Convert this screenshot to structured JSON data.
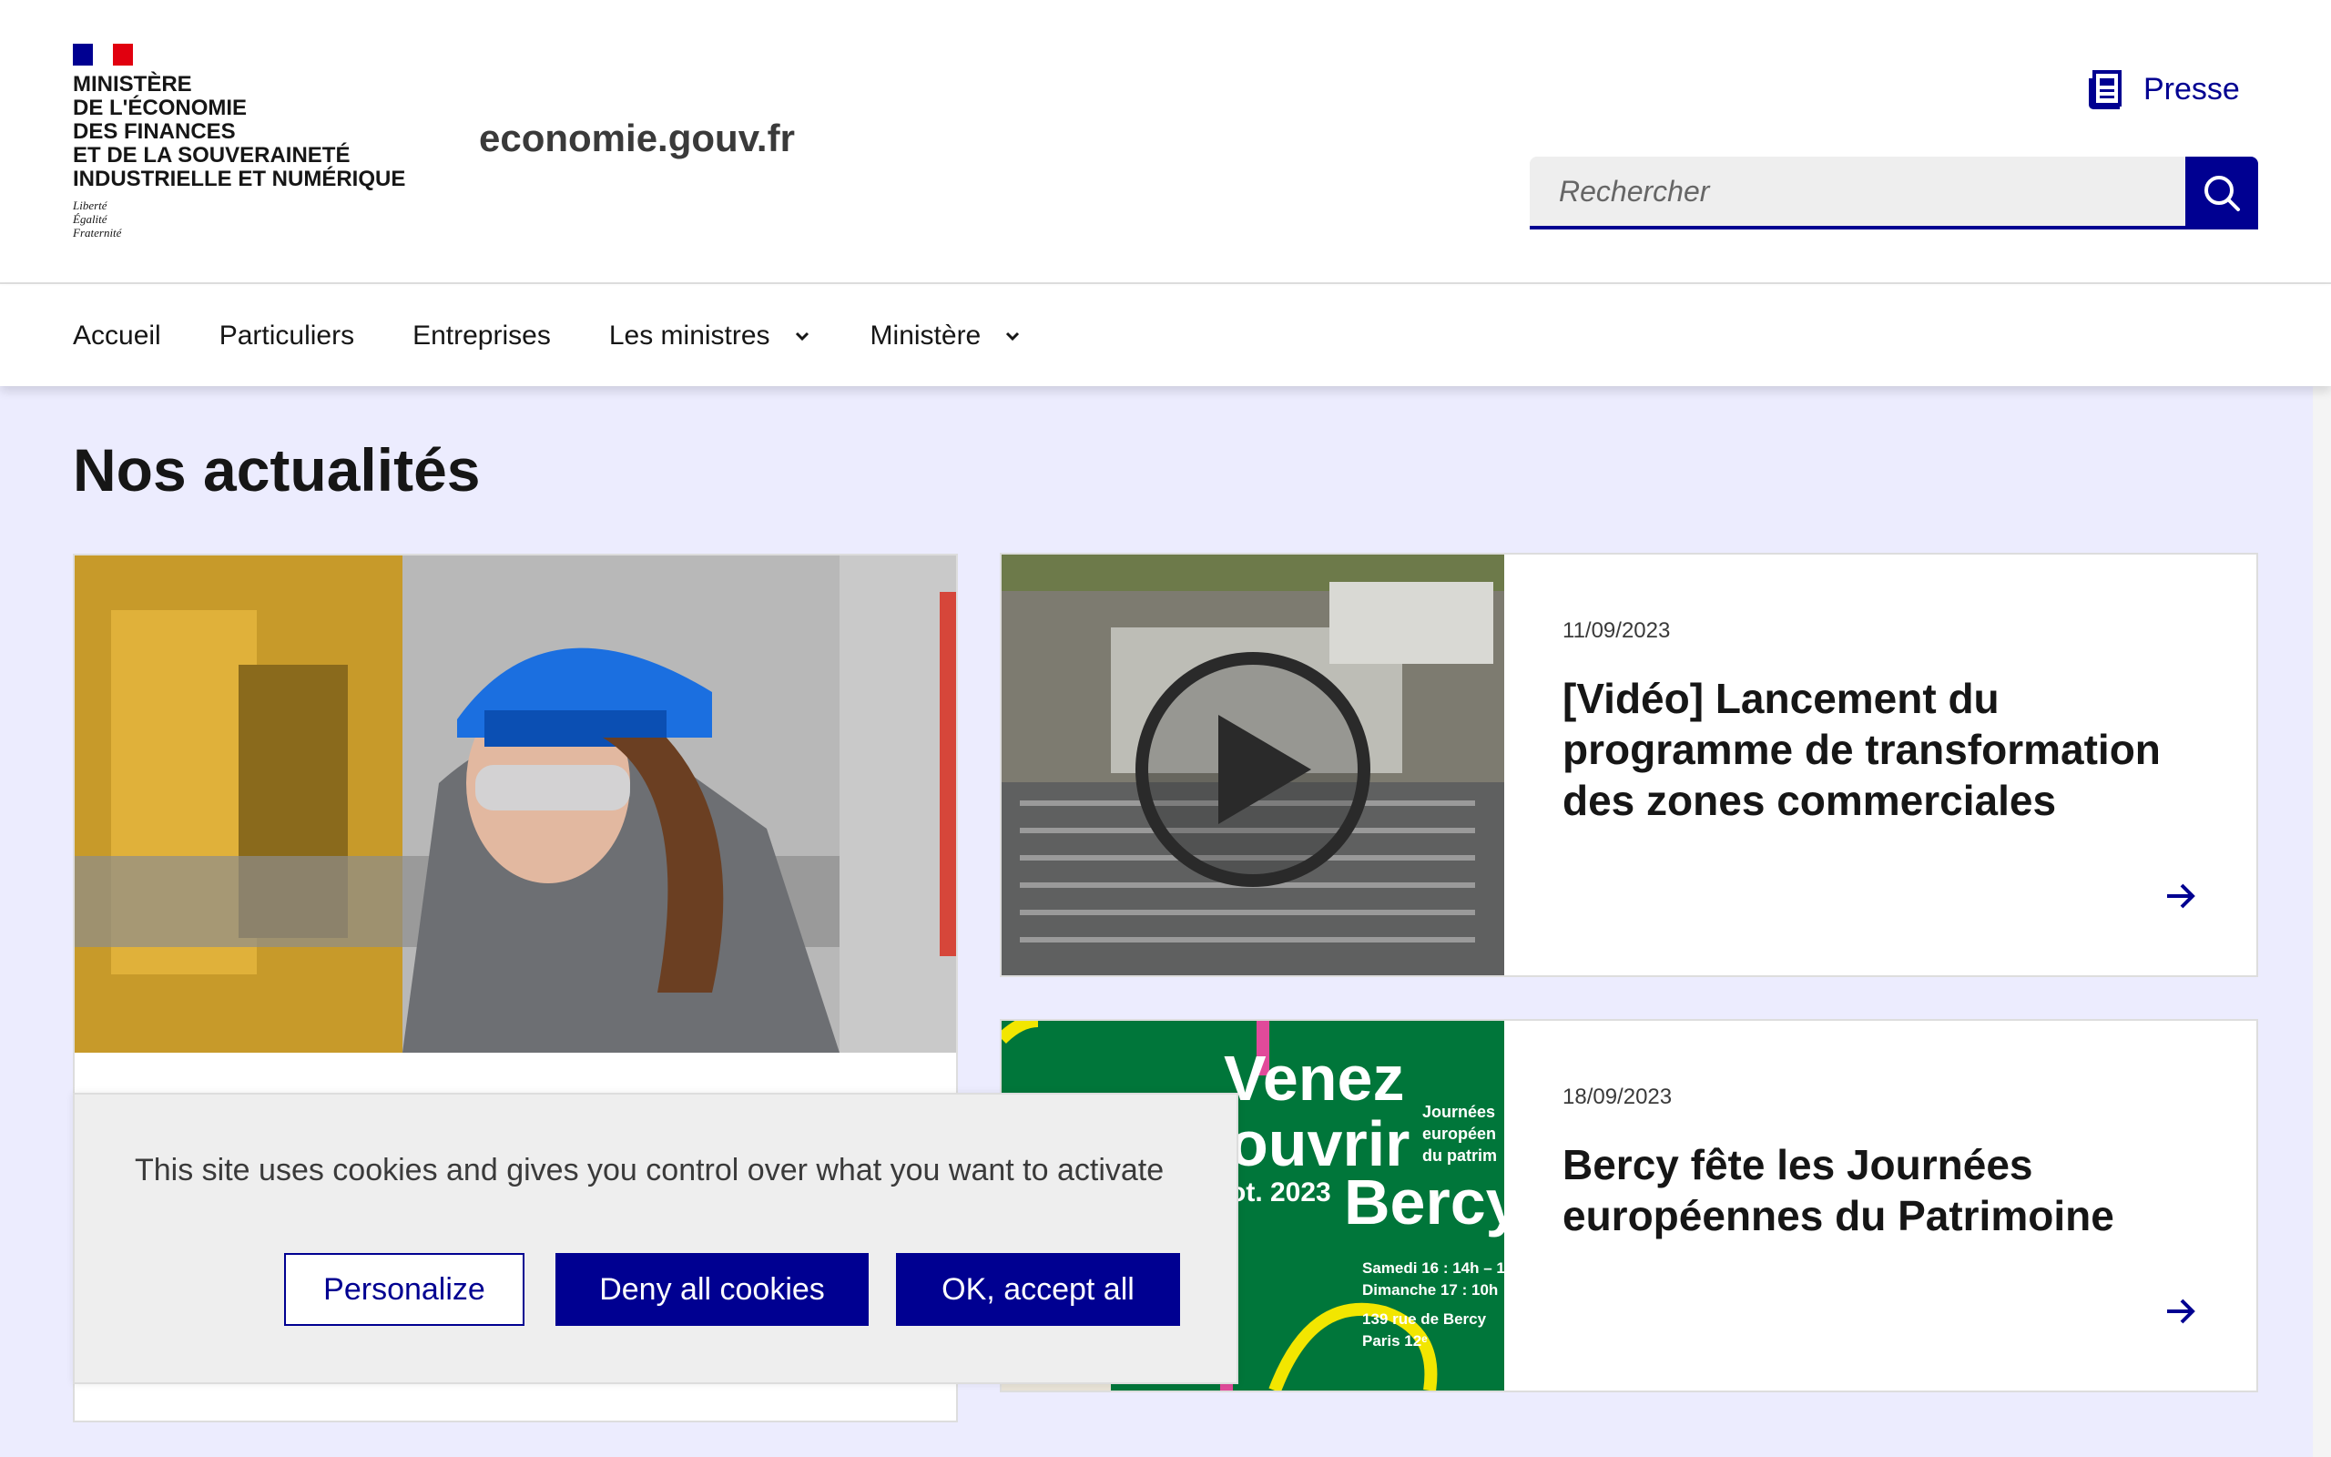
{
  "header": {
    "ministry_lines": [
      "Ministère",
      "de l'Économie",
      "des Finances",
      "et de la Souveraineté",
      "industrielle et numérique"
    ],
    "motto_lines": [
      "Liberté",
      "Égalité",
      "Fraternité"
    ],
    "site_name": "economie.gouv.fr",
    "press_label": "Presse",
    "press_icon": "newspaper-icon",
    "search_placeholder": "Rechercher",
    "search_icon": "search-icon"
  },
  "nav": {
    "items": [
      {
        "label": "Accueil"
      },
      {
        "label": "Particuliers"
      },
      {
        "label": "Entreprises"
      },
      {
        "label": "Les ministres",
        "dropdown": true
      },
      {
        "label": "Ministère",
        "dropdown": true
      }
    ]
  },
  "main": {
    "title": "Nos actualités",
    "cards": [
      {
        "date": "11/09/2023",
        "title": "[Vidéo] Lancement du programme de transformation des zones commerciales",
        "media": "video-thumbnail"
      },
      {
        "date": "18/09/2023",
        "title": "Bercy fête les Journées européennes du Patrimoine",
        "poster_text": {
          "big_lines": [
            "Venez",
            "ouvrir",
            "ot. 2023",
            "Bercy"
          ],
          "side_lines": [
            "Journées",
            "européen",
            "du patrim"
          ],
          "info_lines": [
            "Samedi 16 : 14h – 1",
            "Dimanche 17 : 10h",
            "139 rue de Bercy",
            "Paris 12ᵉ"
          ]
        }
      }
    ]
  },
  "cookie_banner": {
    "text": "This site uses cookies and gives you control over what you want to activate",
    "personalize_label": "Personalize",
    "deny_label": "Deny all cookies",
    "accept_label": "OK, accept all"
  },
  "colors": {
    "primary": "#000091",
    "background_main": "#ececfe",
    "poster_green": "#00763a",
    "flag_red": "#e1000f"
  }
}
